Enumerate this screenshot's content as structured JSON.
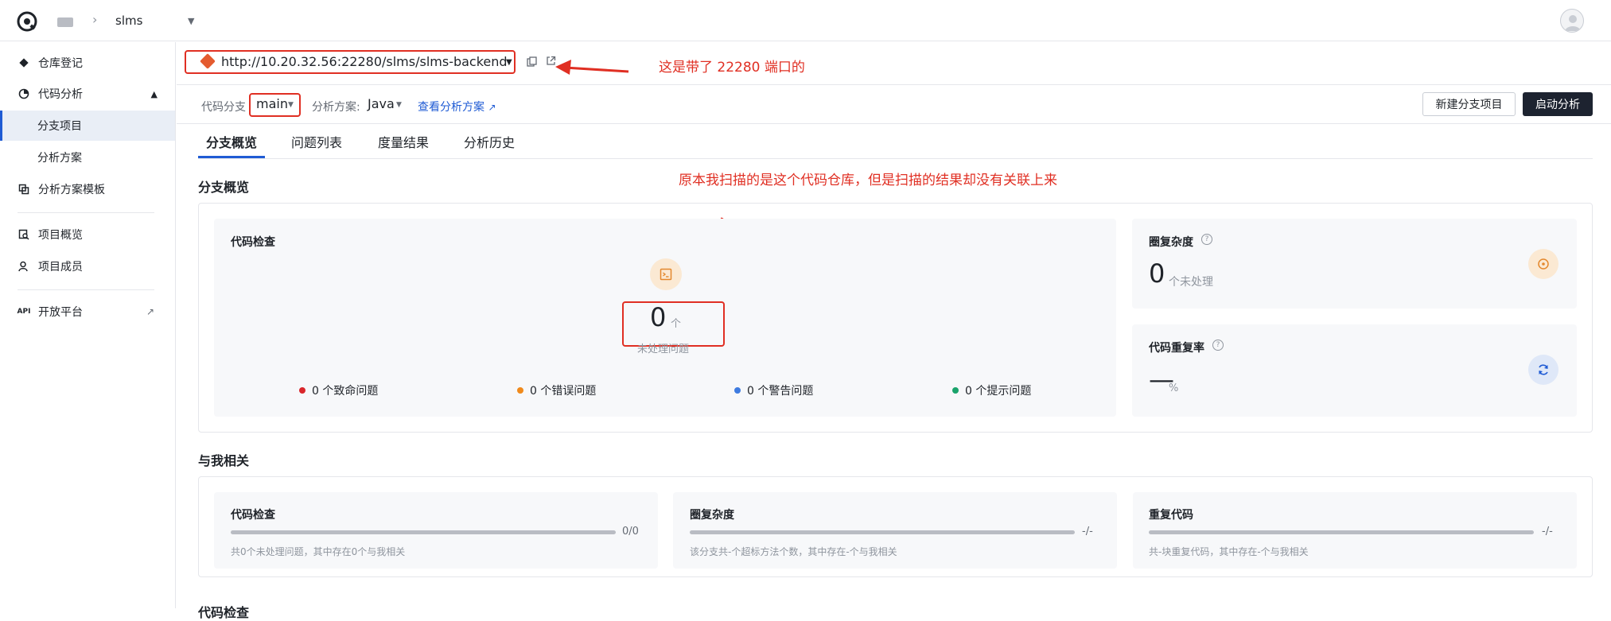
{
  "header": {
    "project": "slms"
  },
  "sidebar": {
    "items": [
      {
        "label": "仓库登记"
      },
      {
        "label": "代码分析"
      },
      {
        "label": "分支项目"
      },
      {
        "label": "分析方案"
      },
      {
        "label": "分析方案模板"
      },
      {
        "label": "项目概览"
      },
      {
        "label": "项目成员"
      },
      {
        "label": "开放平台"
      }
    ],
    "api_badge": "API"
  },
  "repo": {
    "url": "http://10.20.32.56:22280/slms/slms-backend"
  },
  "annotations": {
    "note1": "这是带了 22280 端口的",
    "note2": "原本我扫描的是这个代码仓库，但是扫描的结果却没有关联上来"
  },
  "branch_bar": {
    "branch_label": "代码分支",
    "branch_value": "main",
    "scheme_label": "分析方案:",
    "scheme_value": "Java",
    "scheme_link": "查看分析方案",
    "new_branch_button": "新建分支项目",
    "start_button": "启动分析"
  },
  "tabs": [
    {
      "label": "分支概览"
    },
    {
      "label": "问题列表"
    },
    {
      "label": "度量结果"
    },
    {
      "label": "分析历史"
    }
  ],
  "overview": {
    "title": "分支概览",
    "code_check": {
      "title": "代码检查",
      "count": "0",
      "unit": "个",
      "sub": "未处理问题",
      "severities": [
        {
          "label": "0 个致命问题",
          "color": "#d9262b"
        },
        {
          "label": "0 个错误问题",
          "color": "#f08a1c"
        },
        {
          "label": "0 个警告问题",
          "color": "#3e7be0"
        },
        {
          "label": "0 个提示问题",
          "color": "#1aa36b"
        }
      ]
    },
    "complexity": {
      "title": "圈复杂度",
      "help": "?",
      "value": "0",
      "unit": "个未处理"
    },
    "duplication": {
      "title": "代码重复率",
      "help": "?",
      "value": "—",
      "unit": "%"
    }
  },
  "related": {
    "title": "与我相关",
    "panels": [
      {
        "title": "代码检查",
        "value": "0/0",
        "desc": "共0个未处理问题，其中存在0个与我相关"
      },
      {
        "title": "圈复杂度",
        "value": "-/-",
        "desc": "该分支共-个超标方法个数，其中存在-个与我相关"
      },
      {
        "title": "重复代码",
        "value": "-/-",
        "desc": "共-块重复代码，其中存在-个与我相关"
      }
    ]
  },
  "bottom": {
    "title": "代码检查"
  }
}
